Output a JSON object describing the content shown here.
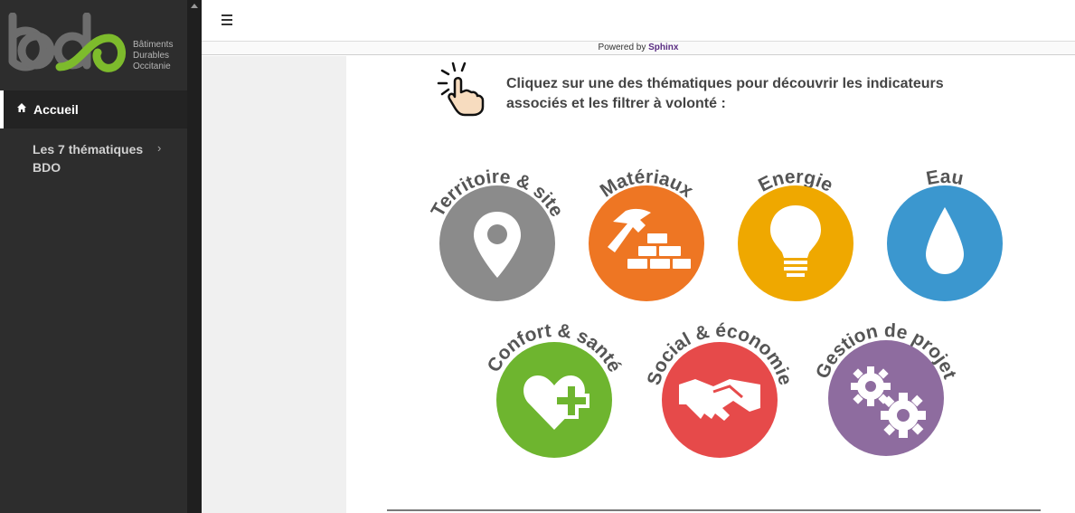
{
  "logo": {
    "letters": "bdo",
    "line1": "Bâtiments",
    "line2": "Durables",
    "line3": "Occitanie",
    "color_gray": "#6d6d6d",
    "color_green": "#7dbb2c"
  },
  "sidebar": {
    "items": [
      {
        "label": "Accueil",
        "icon": "home-icon"
      },
      {
        "label": "Les 7 thématiques BDO",
        "icon": "chevron-right-icon",
        "chevron": "›"
      }
    ]
  },
  "header": {
    "menu_icon": "hamburger-icon",
    "powered_prefix": "Powered by",
    "powered_brand": "Sphinx"
  },
  "main": {
    "intro_icon": "tap-hand-icon",
    "intro_text": "Cliquez sur une des thématiques pour découvrir les indicateurs associés et les filtrer à volonté :",
    "themes": [
      {
        "label": "Territoire & site",
        "icon": "map-pin-icon",
        "color": "#8b8b8b"
      },
      {
        "label": "Matériaux",
        "icon": "hammer-bricks-icon",
        "color": "#ee7623"
      },
      {
        "label": "Energie",
        "icon": "light-bulb-icon",
        "color": "#efa800"
      },
      {
        "label": "Eau",
        "icon": "water-drop-icon",
        "color": "#3b97cf"
      },
      {
        "label": "Confort & santé",
        "icon": "heart-plus-icon",
        "color": "#6eb52f"
      },
      {
        "label": "Social & économie",
        "icon": "handshake-icon",
        "color": "#e64a4a"
      },
      {
        "label": "Gestion de projet",
        "icon": "gears-icon",
        "color": "#8e6c9f"
      }
    ]
  }
}
